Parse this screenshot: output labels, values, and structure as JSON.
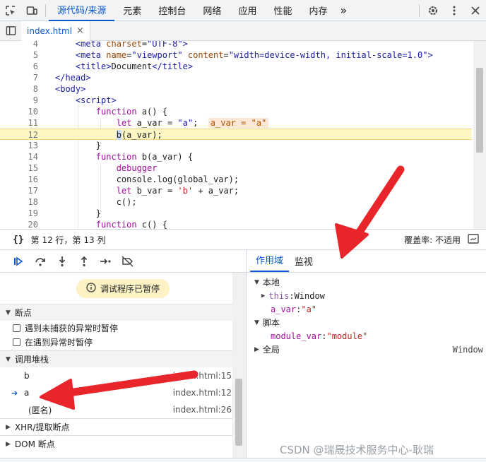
{
  "toolbar": {
    "tabs": [
      "源代码/来源",
      "元素",
      "控制台",
      "网络",
      "应用",
      "性能",
      "内存"
    ],
    "more": "»"
  },
  "filetab": {
    "name": "index.html",
    "close": "×"
  },
  "code_lines": [
    {
      "n": "4",
      "text": "    <meta charset=\"UTF-8\">"
    },
    {
      "n": "5",
      "text": "    <meta name=\"viewport\" content=\"width=device-width, initial-scale=1.0\">"
    },
    {
      "n": "6",
      "text": "    <title>Document</title>"
    },
    {
      "n": "7",
      "text": "</head>"
    },
    {
      "n": "8",
      "text": "<body>"
    },
    {
      "n": "9",
      "text": "    <script>"
    },
    {
      "n": "10",
      "text": "        function a() {"
    },
    {
      "n": "11",
      "text": "            let a_var = \"a\";"
    },
    {
      "n": "12",
      "text": "            b(a_var);"
    },
    {
      "n": "13",
      "text": "        }"
    },
    {
      "n": "14",
      "text": "        function b(a_var) {"
    },
    {
      "n": "15",
      "text": "            debugger"
    },
    {
      "n": "16",
      "text": "            console.log(global_var);"
    },
    {
      "n": "17",
      "text": "            let b_var = 'b' + a_var;"
    },
    {
      "n": "18",
      "text": "            c();"
    },
    {
      "n": "19",
      "text": "        }"
    },
    {
      "n": "20",
      "text": "        function c() {"
    }
  ],
  "inline_value": "a_var = \"a\"",
  "status": {
    "braces": "{}",
    "position": "第 12 行，第 13 列",
    "coverage": "覆盖率: 不适用"
  },
  "debugger": {
    "paused": "调试程序已暂停",
    "breakpoints_title": "断点",
    "cb_uncaught": "遇到未捕获的异常时暂停",
    "cb_caught": "在遇到异常时暂停",
    "callstack_title": "调用堆栈",
    "frames": [
      {
        "name": "b",
        "loc": "index.html:15"
      },
      {
        "name": "a",
        "loc": "index.html:12"
      },
      {
        "name": "(匿名)",
        "loc": "index.html:26"
      }
    ],
    "xhr": "XHR/提取断点",
    "dom": "DOM 断点"
  },
  "scope": {
    "tab_scope": "作用域",
    "tab_watch": "监视",
    "local": "本地",
    "this_key": "this",
    "this_val": "Window",
    "a_var_key": "a_var",
    "a_var_val": "\"a\"",
    "script": "脚本",
    "module_key": "module_var",
    "module_val": "\"module\"",
    "global": "全局",
    "global_val": "Window"
  },
  "watermark": "CSDN @瑞晟技术服务中心-耿瑞",
  "colors": {
    "accent": "#0b57d0",
    "arrow": "#e8252a",
    "highlight": "#fff8c5"
  }
}
